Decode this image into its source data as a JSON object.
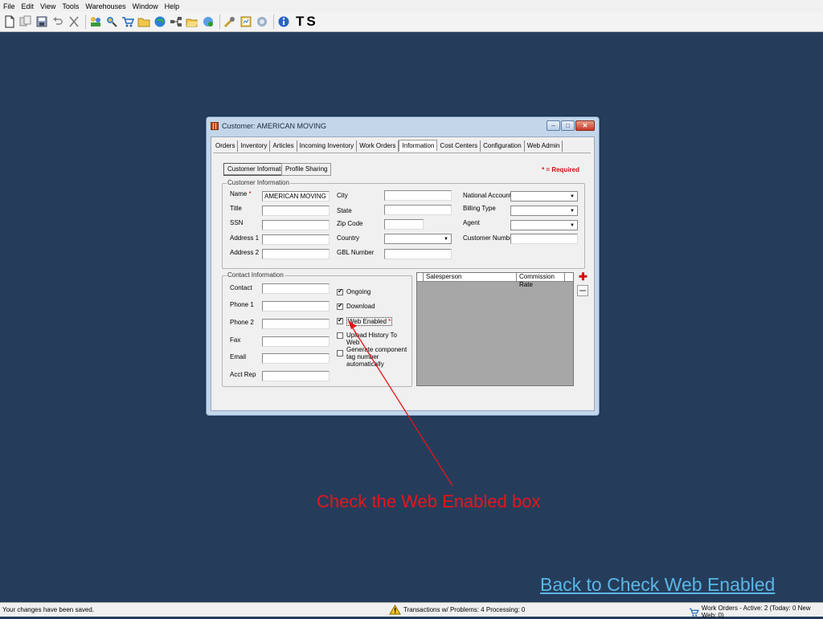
{
  "menu": [
    "File",
    "Edit",
    "View",
    "Tools",
    "Warehouses",
    "Window",
    "Help"
  ],
  "toolbar": {
    "ts_label": "TS"
  },
  "window": {
    "title": "Customer: AMERICAN MOVING",
    "tabs": [
      "Orders",
      "Inventory",
      "Articles",
      "Incoming Inventory",
      "Work Orders",
      "Information",
      "Cost Centers",
      "Configuration",
      "Web Admin"
    ],
    "active_tab": "Information",
    "subtabs": [
      "Customer Information",
      "Profile Sharing"
    ],
    "required_note": "* = Required"
  },
  "customer_info": {
    "legend": "Customer Information",
    "name_label": "Name",
    "name_value": "AMERICAN MOVING",
    "title_label": "Title",
    "ssn_label": "SSN",
    "address1_label": "Address 1",
    "address2_label": "Address 2",
    "city_label": "City",
    "state_label": "State",
    "zip_label": "Zip Code",
    "country_label": "Country",
    "gbl_label": "GBL Number",
    "national_account_label": "National Account",
    "billing_type_label": "Billing Type",
    "agent_label": "Agent",
    "customer_number_label": "Customer Number"
  },
  "contact_info": {
    "legend": "Contact Information",
    "contact_label": "Contact",
    "phone1_label": "Phone 1",
    "phone2_label": "Phone 2",
    "fax_label": "Fax",
    "email_label": "Email",
    "acct_rep_label": "Acct Rep",
    "ongoing_label": "Ongoing",
    "ongoing_checked": true,
    "download_label": "Download",
    "download_checked": true,
    "web_enabled_label": "Web Enabled",
    "web_enabled_checked": true,
    "upload_label": "Upload History To Web",
    "upload_checked": false,
    "generate_label": "Generate component tag number automatically",
    "generate_checked": false
  },
  "sales_grid": {
    "col_salesperson": "Salesperson",
    "col_commission": "Commission Rate"
  },
  "annotation": "Check the Web Enabled box",
  "back_link": "Back to Check Web Enabled",
  "status": {
    "left": "Your changes have been saved.",
    "middle": "Transactions w/ Problems: 4  Processing: 0",
    "right": "Work Orders - Active: 2  (Today: 0  New Web: 0)"
  },
  "colors": {
    "desktop": "#253d5b",
    "annotation": "#e8141b",
    "link": "#5bb6e6",
    "required": "#d01010"
  }
}
